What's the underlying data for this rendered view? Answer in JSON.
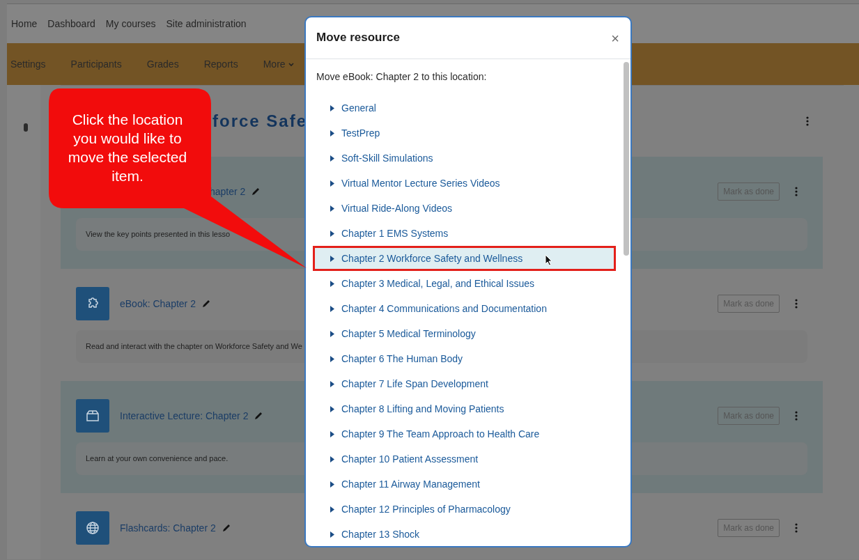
{
  "top_nav": [
    {
      "label": "Home"
    },
    {
      "label": "Dashboard"
    },
    {
      "label": "My courses"
    },
    {
      "label": "Site administration"
    }
  ],
  "course_nav": [
    {
      "label": "Settings",
      "has_menu": false
    },
    {
      "label": "Participants",
      "has_menu": false
    },
    {
      "label": "Grades",
      "has_menu": false
    },
    {
      "label": "Reports",
      "has_menu": false
    },
    {
      "label": "More",
      "has_menu": true
    }
  ],
  "course_heading": "force Safe",
  "activities": [
    {
      "kind": "lesson",
      "title": "hapter 2",
      "description": "View the key points presented in this lesso",
      "highlighted": true,
      "button": "Mark as done"
    },
    {
      "kind": "book",
      "title": "eBook: Chapter 2",
      "description": "Read and interact with the chapter on Workforce Safety and We",
      "highlighted": false,
      "button": "Mark as done"
    },
    {
      "kind": "lecture",
      "title": "Interactive Lecture: Chapter 2",
      "description": "Learn at your own convenience and pace.",
      "highlighted": true,
      "button": "Mark as done"
    },
    {
      "kind": "flashcards",
      "title": "Flashcards: Chapter 2",
      "highlighted": false,
      "button": "Mark as done"
    }
  ],
  "modal": {
    "title": "Move resource",
    "close": "×",
    "intro": "Move eBook: Chapter 2 to this location:",
    "locations": [
      {
        "label": "General",
        "selected": false
      },
      {
        "label": "TestPrep",
        "selected": false
      },
      {
        "label": "Soft-Skill Simulations",
        "selected": false
      },
      {
        "label": "Virtual Mentor Lecture Series Videos",
        "selected": false
      },
      {
        "label": "Virtual Ride-Along Videos",
        "selected": false
      },
      {
        "label": "Chapter 1 EMS Systems",
        "selected": false
      },
      {
        "label": "Chapter 2 Workforce Safety and Wellness",
        "selected": true
      },
      {
        "label": "Chapter 3 Medical, Legal, and Ethical Issues",
        "selected": false
      },
      {
        "label": "Chapter 4 Communications and Documentation",
        "selected": false
      },
      {
        "label": "Chapter 5 Medical Terminology",
        "selected": false
      },
      {
        "label": "Chapter 6 The Human Body",
        "selected": false
      },
      {
        "label": "Chapter 7 Life Span Development",
        "selected": false
      },
      {
        "label": "Chapter 8 Lifting and Moving Patients",
        "selected": false
      },
      {
        "label": "Chapter 9 The Team Approach to Health Care",
        "selected": false
      },
      {
        "label": "Chapter 10 Patient Assessment",
        "selected": false
      },
      {
        "label": "Chapter 11 Airway Management",
        "selected": false
      },
      {
        "label": "Chapter 12 Principles of Pharmacology",
        "selected": false
      },
      {
        "label": "Chapter 13 Shock",
        "selected": false
      }
    ]
  },
  "callout": {
    "text": "Click the location you would like to move the selected item."
  }
}
